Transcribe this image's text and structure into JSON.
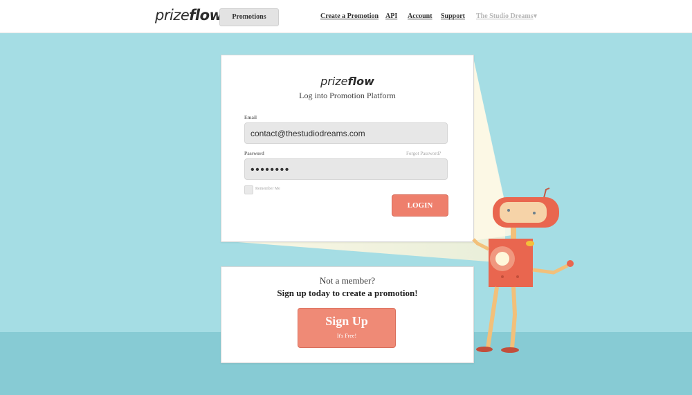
{
  "header": {
    "logo_regular": "prize",
    "logo_bold": "flow",
    "promotions_label": "Promotions",
    "nav": [
      {
        "label": "Create a Promotion"
      },
      {
        "label": "API"
      },
      {
        "label": "Account"
      },
      {
        "label": "Support"
      },
      {
        "label": "The Studio Dreams"
      }
    ]
  },
  "login": {
    "logo_regular": "prize",
    "logo_bold": "flow",
    "title": "Log into Promotion Platform",
    "email_label": "Email",
    "email_value": "contact@thestudiodreams.com",
    "password_label": "Password",
    "forgot_label": "Forgot Password?",
    "password_value": "••••••••",
    "remember_label": "Remember Me",
    "login_button": "LOGIN"
  },
  "signup": {
    "line1": "Not a member?",
    "line2": "Sign up today to create a promotion!",
    "button_main": "Sign Up",
    "button_sub": "It's Free!"
  },
  "colors": {
    "sky": "#a5dde4",
    "floor": "#87cbd4",
    "accent": "#ee7f6c"
  }
}
